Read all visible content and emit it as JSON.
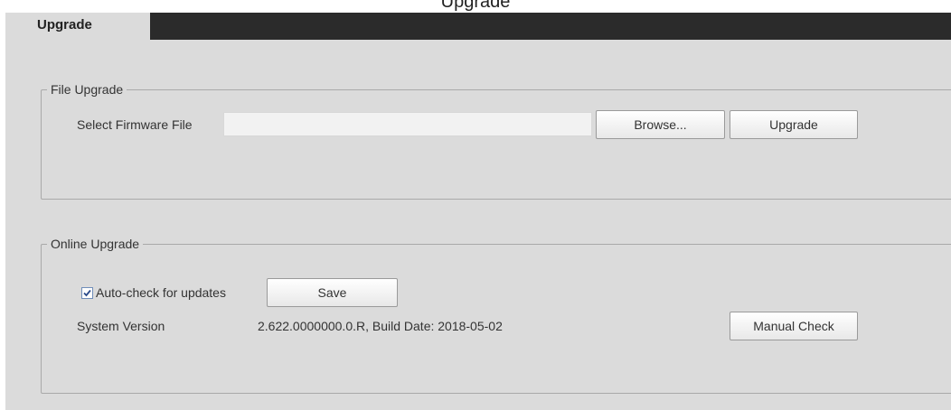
{
  "window_title": "Upgrade",
  "tabs": [
    {
      "label": "Upgrade",
      "active": true
    }
  ],
  "file_upgrade": {
    "legend": "File Upgrade",
    "select_label": "Select Firmware File",
    "file_value": "",
    "browse_label": "Browse...",
    "upgrade_label": "Upgrade"
  },
  "online_upgrade": {
    "legend": "Online Upgrade",
    "auto_check_label": "Auto-check for updates",
    "auto_check_checked": true,
    "save_label": "Save",
    "system_version_label": "System Version",
    "system_version_value": "2.622.0000000.0.R, Build Date: 2018-05-02",
    "manual_check_label": "Manual Check"
  },
  "colors": {
    "panel_bg": "#dbdbdb",
    "tab_bar": "#2b2b2b",
    "checkbox_border": "#6f8db9",
    "check_mark": "#2b4a8a"
  }
}
